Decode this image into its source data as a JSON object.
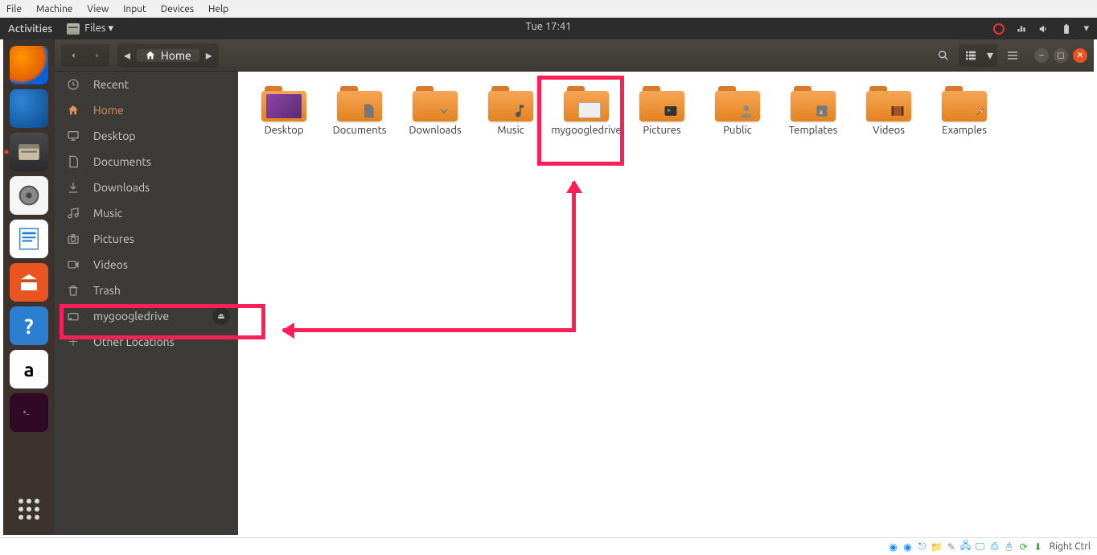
{
  "vbox_menu": [
    "File",
    "Machine",
    "View",
    "Input",
    "Devices",
    "Help"
  ],
  "topbar": {
    "activities": "Activities",
    "app_label": "Files ▾",
    "clock": "Tue 17:41"
  },
  "header": {
    "home_label": "Home"
  },
  "sidebar": {
    "items": [
      {
        "icon": "clock",
        "label": "Recent"
      },
      {
        "icon": "home",
        "label": "Home",
        "active": true
      },
      {
        "icon": "desktop",
        "label": "Desktop"
      },
      {
        "icon": "doc",
        "label": "Documents"
      },
      {
        "icon": "download",
        "label": "Downloads"
      },
      {
        "icon": "music",
        "label": "Music"
      },
      {
        "icon": "camera",
        "label": "Pictures"
      },
      {
        "icon": "video",
        "label": "Videos"
      },
      {
        "icon": "trash",
        "label": "Trash"
      },
      {
        "icon": "drive",
        "label": "mygoogledrive",
        "eject": true
      },
      {
        "icon": "plus",
        "label": "Other Locations"
      }
    ]
  },
  "folders": [
    {
      "label": "Desktop",
      "overlay": "desktop"
    },
    {
      "label": "Documents",
      "overlay": "doc"
    },
    {
      "label": "Downloads",
      "overlay": "download"
    },
    {
      "label": "Music",
      "overlay": "music"
    },
    {
      "label": "mygoogledrive",
      "overlay": "drive",
      "highlight": true
    },
    {
      "label": "Pictures",
      "overlay": "pictures"
    },
    {
      "label": "Public",
      "overlay": "public"
    },
    {
      "label": "Templates",
      "overlay": "templates"
    },
    {
      "label": "Videos",
      "overlay": "videos"
    },
    {
      "label": "Examples",
      "overlay": "link"
    }
  ],
  "vbox_status": {
    "label": "Right Ctrl"
  }
}
